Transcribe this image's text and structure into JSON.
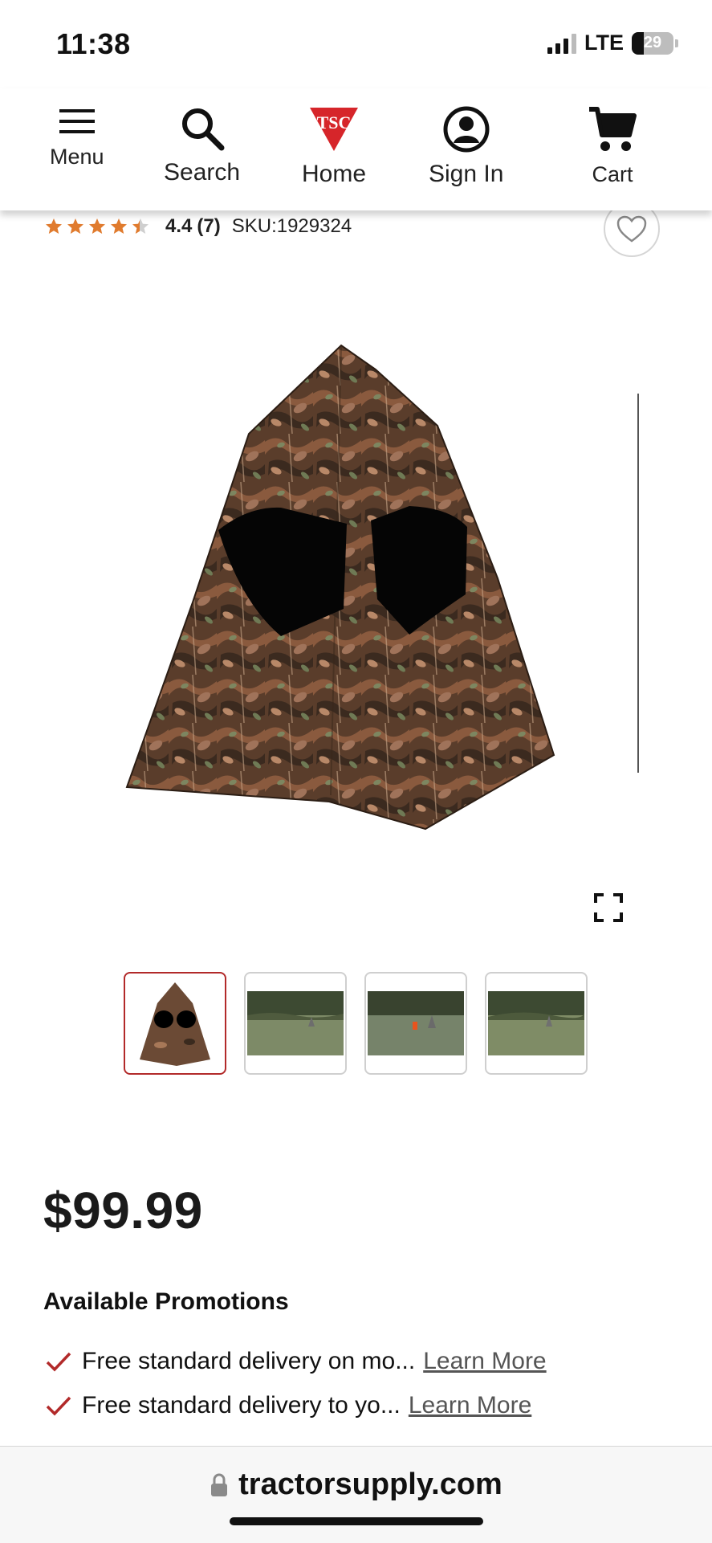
{
  "status_bar": {
    "time": "11:38",
    "network": "LTE",
    "battery": "29"
  },
  "nav": {
    "menu": "Menu",
    "search": "Search",
    "home": "Home",
    "sign_in": "Sign In",
    "cart": "Cart",
    "logo_text": "TSC"
  },
  "product": {
    "rating": "4.4",
    "rating_stars": 4.4,
    "review_count": "(7)",
    "sku": "SKU:1929324",
    "price": "$99.99"
  },
  "promotions": {
    "title": "Available Promotions",
    "items": [
      {
        "text": "Free standard delivery on mo...",
        "link": "Learn More"
      },
      {
        "text": "Free standard delivery to yo...",
        "link": "Learn More"
      }
    ]
  },
  "browser": {
    "url": "tractorsupply.com"
  },
  "colors": {
    "accent_red": "#b22a2a",
    "star_orange": "#e07b2e",
    "logo_red": "#d6252a"
  },
  "icons": [
    "menu-icon",
    "search-icon",
    "tsc-logo",
    "account-icon",
    "cart-icon",
    "heart-icon",
    "expand-icon",
    "check-icon",
    "lock-icon"
  ]
}
